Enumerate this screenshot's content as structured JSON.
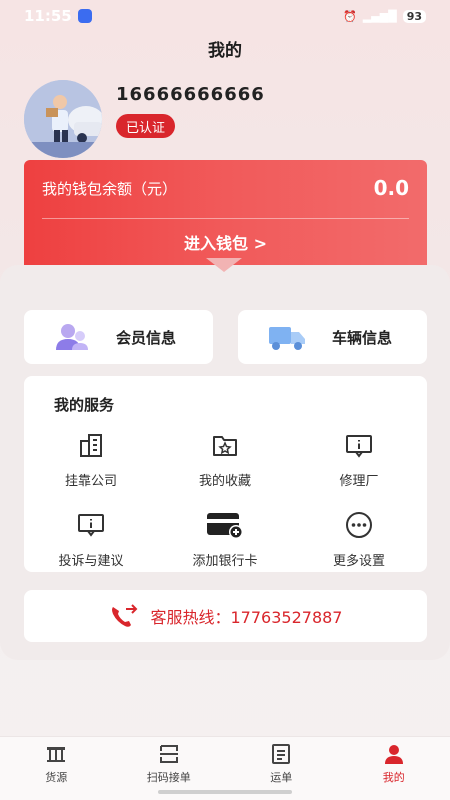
{
  "status_bar": {
    "time": "11:55",
    "battery": "93"
  },
  "header": {
    "title": "我的"
  },
  "profile": {
    "phone": "16666666666",
    "badge": "已认证"
  },
  "wallet": {
    "label": "我的钱包余额（元）",
    "amount": "0.0",
    "enter_label": "进入钱包 >"
  },
  "quick_cards": [
    {
      "label": "会员信息",
      "icon": "member-icon"
    },
    {
      "label": "车辆信息",
      "icon": "truck-icon"
    }
  ],
  "services": {
    "title": "我的服务",
    "items": [
      {
        "label": "挂靠公司",
        "icon": "building-icon"
      },
      {
        "label": "我的收藏",
        "icon": "star-folder-icon"
      },
      {
        "label": "修理厂",
        "icon": "info-card-icon"
      },
      {
        "label": "投诉与建议",
        "icon": "feedback-icon"
      },
      {
        "label": "添加银行卡",
        "icon": "add-card-icon"
      },
      {
        "label": "更多设置",
        "icon": "more-icon"
      }
    ]
  },
  "hotline": {
    "text": "客服热线：17763527887",
    "icon": "phone-icon"
  },
  "tab_bar": {
    "items": [
      {
        "label": "货源",
        "icon": "cargo-icon",
        "active": false
      },
      {
        "label": "扫码接单",
        "icon": "scan-icon",
        "active": false
      },
      {
        "label": "运单",
        "icon": "waybill-icon",
        "active": false
      },
      {
        "label": "我的",
        "icon": "profile-icon",
        "active": true
      }
    ]
  },
  "colors": {
    "accent": "#d9262c",
    "wallet_start": "#ee4040",
    "wallet_end": "#f26b6b"
  }
}
